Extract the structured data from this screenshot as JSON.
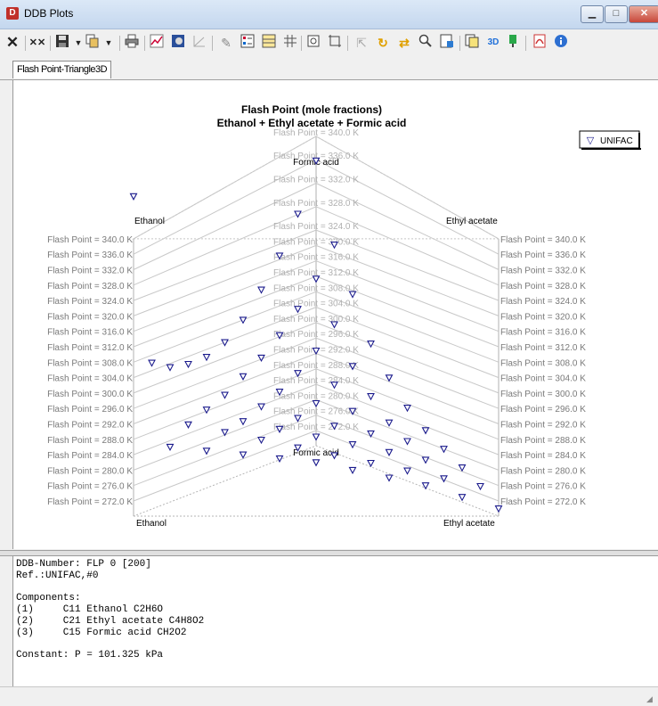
{
  "window": {
    "title": "DDB Plots",
    "minimize": "▁",
    "maximize": "□",
    "close": "✕"
  },
  "toolbar": {
    "icons": [
      "close-icon",
      "clear-icon",
      "save-icon",
      "copy-icon",
      "print-icon",
      "chart-icon",
      "fill-icon",
      "axis-icon",
      "cursor-icon",
      "legend-icon",
      "table-icon",
      "grid-icon",
      "zoom-fit-icon",
      "crop-icon",
      "select-icon",
      "rotate-icon",
      "pan-icon",
      "zoom-icon",
      "export-icon",
      "copy-page-icon",
      "3d-icon",
      "color-icon",
      "pdf-icon",
      "info-icon"
    ],
    "label_3d": "3D"
  },
  "tabs": [
    {
      "label": "Flash Point-Triangle3D",
      "active": true
    }
  ],
  "chart_data": {
    "type": "scatter",
    "title": "Flash Point (mole fractions)",
    "subtitle": "Ethanol + Ethyl acetate + Formic acid",
    "components": {
      "left": "Ethanol",
      "right": "Ethyl acetate",
      "top": "Formic acid"
    },
    "z_ticks": [
      "Flash Point = 340.0 K",
      "Flash Point = 336.0 K",
      "Flash Point = 332.0 K",
      "Flash Point = 328.0 K",
      "Flash Point = 324.0 K",
      "Flash Point = 320.0 K",
      "Flash Point = 316.0 K",
      "Flash Point = 312.0 K",
      "Flash Point = 308.0 K",
      "Flash Point = 304.0 K",
      "Flash Point = 300.0 K",
      "Flash Point = 296.0 K",
      "Flash Point = 292.0 K",
      "Flash Point = 288.0 K",
      "Flash Point = 284.0 K",
      "Flash Point = 280.0 K",
      "Flash Point = 276.0 K",
      "Flash Point = 272.0 K"
    ],
    "zlim": [
      272,
      340
    ],
    "legend": {
      "marker": "▽",
      "label": "UNIFAC",
      "position": "top-right"
    },
    "series": [
      {
        "name": "UNIFAC",
        "color": "#1a1a8c",
        "points": [
          {
            "ethanol": 1.0,
            "ethyl_acetate": 0.0,
            "formic_acid": 0.0,
            "T": 351.0
          },
          {
            "ethanol": 0.9,
            "ethyl_acetate": 0.0,
            "formic_acid": 0.1,
            "T": 306.0
          },
          {
            "ethanol": 0.8,
            "ethyl_acetate": 0.0,
            "formic_acid": 0.2,
            "T": 303.0
          },
          {
            "ethanol": 0.7,
            "ethyl_acetate": 0.0,
            "formic_acid": 0.3,
            "T": 302.0
          },
          {
            "ethanol": 0.6,
            "ethyl_acetate": 0.0,
            "formic_acid": 0.4,
            "T": 302.0
          },
          {
            "ethanol": 0.5,
            "ethyl_acetate": 0.0,
            "formic_acid": 0.5,
            "T": 304.0
          },
          {
            "ethanol": 0.4,
            "ethyl_acetate": 0.0,
            "formic_acid": 0.6,
            "T": 308.0
          },
          {
            "ethanol": 0.3,
            "ethyl_acetate": 0.0,
            "formic_acid": 0.7,
            "T": 314.0
          },
          {
            "ethanol": 0.2,
            "ethyl_acetate": 0.0,
            "formic_acid": 0.8,
            "T": 321.0
          },
          {
            "ethanol": 0.1,
            "ethyl_acetate": 0.0,
            "formic_acid": 0.9,
            "T": 330.0
          },
          {
            "ethanol": 0.0,
            "ethyl_acetate": 0.0,
            "formic_acid": 1.0,
            "T": 342.0
          },
          {
            "ethanol": 0.9,
            "ethyl_acetate": 0.1,
            "formic_acid": 0.0,
            "T": 286.0
          },
          {
            "ethanol": 0.8,
            "ethyl_acetate": 0.2,
            "formic_acid": 0.0,
            "T": 285.0
          },
          {
            "ethanol": 0.7,
            "ethyl_acetate": 0.3,
            "formic_acid": 0.0,
            "T": 284.0
          },
          {
            "ethanol": 0.6,
            "ethyl_acetate": 0.4,
            "formic_acid": 0.0,
            "T": 283.0
          },
          {
            "ethanol": 0.5,
            "ethyl_acetate": 0.5,
            "formic_acid": 0.0,
            "T": 282.0
          },
          {
            "ethanol": 0.4,
            "ethyl_acetate": 0.6,
            "formic_acid": 0.0,
            "T": 280.0
          },
          {
            "ethanol": 0.3,
            "ethyl_acetate": 0.7,
            "formic_acid": 0.0,
            "T": 278.0
          },
          {
            "ethanol": 0.2,
            "ethyl_acetate": 0.8,
            "formic_acid": 0.0,
            "T": 276.0
          },
          {
            "ethanol": 0.1,
            "ethyl_acetate": 0.9,
            "formic_acid": 0.0,
            "T": 273.0
          },
          {
            "ethanol": 0.0,
            "ethyl_acetate": 1.0,
            "formic_acid": 0.0,
            "T": 270.0
          },
          {
            "ethanol": 0.8,
            "ethyl_acetate": 0.1,
            "formic_acid": 0.1,
            "T": 290.0
          },
          {
            "ethanol": 0.7,
            "ethyl_acetate": 0.1,
            "formic_acid": 0.2,
            "T": 292.0
          },
          {
            "ethanol": 0.6,
            "ethyl_acetate": 0.1,
            "formic_acid": 0.3,
            "T": 294.0
          },
          {
            "ethanol": 0.5,
            "ethyl_acetate": 0.1,
            "formic_acid": 0.4,
            "T": 297.0
          },
          {
            "ethanol": 0.4,
            "ethyl_acetate": 0.1,
            "formic_acid": 0.5,
            "T": 300.0
          },
          {
            "ethanol": 0.3,
            "ethyl_acetate": 0.1,
            "formic_acid": 0.6,
            "T": 304.0
          },
          {
            "ethanol": 0.2,
            "ethyl_acetate": 0.1,
            "formic_acid": 0.7,
            "T": 309.0
          },
          {
            "ethanol": 0.1,
            "ethyl_acetate": 0.1,
            "formic_acid": 0.8,
            "T": 315.0
          },
          {
            "ethanol": 0.0,
            "ethyl_acetate": 0.1,
            "formic_acid": 0.9,
            "T": 322.0
          },
          {
            "ethanol": 0.7,
            "ethyl_acetate": 0.2,
            "formic_acid": 0.1,
            "T": 288.0
          },
          {
            "ethanol": 0.6,
            "ethyl_acetate": 0.2,
            "formic_acid": 0.2,
            "T": 289.0
          },
          {
            "ethanol": 0.5,
            "ethyl_acetate": 0.2,
            "formic_acid": 0.3,
            "T": 291.0
          },
          {
            "ethanol": 0.4,
            "ethyl_acetate": 0.2,
            "formic_acid": 0.4,
            "T": 293.0
          },
          {
            "ethanol": 0.3,
            "ethyl_acetate": 0.2,
            "formic_acid": 0.5,
            "T": 296.0
          },
          {
            "ethanol": 0.2,
            "ethyl_acetate": 0.2,
            "formic_acid": 0.6,
            "T": 300.0
          },
          {
            "ethanol": 0.1,
            "ethyl_acetate": 0.2,
            "formic_acid": 0.7,
            "T": 305.0
          },
          {
            "ethanol": 0.0,
            "ethyl_acetate": 0.2,
            "formic_acid": 0.8,
            "T": 311.0
          },
          {
            "ethanol": 0.6,
            "ethyl_acetate": 0.3,
            "formic_acid": 0.1,
            "T": 286.0
          },
          {
            "ethanol": 0.5,
            "ethyl_acetate": 0.3,
            "formic_acid": 0.2,
            "T": 287.0
          },
          {
            "ethanol": 0.4,
            "ethyl_acetate": 0.3,
            "formic_acid": 0.3,
            "T": 288.0
          },
          {
            "ethanol": 0.3,
            "ethyl_acetate": 0.3,
            "formic_acid": 0.4,
            "T": 290.0
          },
          {
            "ethanol": 0.2,
            "ethyl_acetate": 0.3,
            "formic_acid": 0.5,
            "T": 293.0
          },
          {
            "ethanol": 0.1,
            "ethyl_acetate": 0.3,
            "formic_acid": 0.6,
            "T": 296.0
          },
          {
            "ethanol": 0.0,
            "ethyl_acetate": 0.3,
            "formic_acid": 0.7,
            "T": 300.0
          },
          {
            "ethanol": 0.5,
            "ethyl_acetate": 0.4,
            "formic_acid": 0.1,
            "T": 284.0
          },
          {
            "ethanol": 0.4,
            "ethyl_acetate": 0.4,
            "formic_acid": 0.2,
            "T": 285.0
          },
          {
            "ethanol": 0.3,
            "ethyl_acetate": 0.4,
            "formic_acid": 0.3,
            "T": 286.0
          },
          {
            "ethanol": 0.2,
            "ethyl_acetate": 0.4,
            "formic_acid": 0.4,
            "T": 288.0
          },
          {
            "ethanol": 0.1,
            "ethyl_acetate": 0.4,
            "formic_acid": 0.5,
            "T": 290.0
          },
          {
            "ethanol": 0.0,
            "ethyl_acetate": 0.4,
            "formic_acid": 0.6,
            "T": 293.0
          },
          {
            "ethanol": 0.4,
            "ethyl_acetate": 0.5,
            "formic_acid": 0.1,
            "T": 282.0
          },
          {
            "ethanol": 0.3,
            "ethyl_acetate": 0.5,
            "formic_acid": 0.2,
            "T": 283.0
          },
          {
            "ethanol": 0.2,
            "ethyl_acetate": 0.5,
            "formic_acid": 0.3,
            "T": 284.0
          },
          {
            "ethanol": 0.1,
            "ethyl_acetate": 0.5,
            "formic_acid": 0.4,
            "T": 285.0
          },
          {
            "ethanol": 0.0,
            "ethyl_acetate": 0.5,
            "formic_acid": 0.5,
            "T": 287.0
          },
          {
            "ethanol": 0.3,
            "ethyl_acetate": 0.6,
            "formic_acid": 0.1,
            "T": 280.0
          },
          {
            "ethanol": 0.2,
            "ethyl_acetate": 0.6,
            "formic_acid": 0.2,
            "T": 281.0
          },
          {
            "ethanol": 0.1,
            "ethyl_acetate": 0.6,
            "formic_acid": 0.3,
            "T": 282.0
          },
          {
            "ethanol": 0.0,
            "ethyl_acetate": 0.6,
            "formic_acid": 0.4,
            "T": 283.0
          },
          {
            "ethanol": 0.2,
            "ethyl_acetate": 0.7,
            "formic_acid": 0.1,
            "T": 278.0
          },
          {
            "ethanol": 0.1,
            "ethyl_acetate": 0.7,
            "formic_acid": 0.2,
            "T": 279.0
          },
          {
            "ethanol": 0.0,
            "ethyl_acetate": 0.7,
            "formic_acid": 0.3,
            "T": 280.0
          },
          {
            "ethanol": 0.1,
            "ethyl_acetate": 0.8,
            "formic_acid": 0.1,
            "T": 276.0
          },
          {
            "ethanol": 0.0,
            "ethyl_acetate": 0.8,
            "formic_acid": 0.2,
            "T": 277.0
          },
          {
            "ethanol": 0.0,
            "ethyl_acetate": 0.9,
            "formic_acid": 0.1,
            "T": 274.0
          }
        ]
      }
    ]
  },
  "info_lines": [
    "DDB-Number: FLP 0 [200]",
    "Ref.:UNIFAC,#0",
    "",
    "Components:",
    "(1)     C11 Ethanol C2H6O",
    "(2)     C21 Ethyl acetate C4H8O2",
    "(3)     C15 Formic acid CH2O2",
    "",
    "Constant: P = 101.325 kPa"
  ]
}
